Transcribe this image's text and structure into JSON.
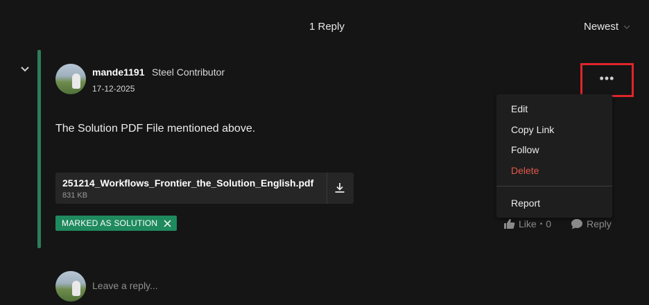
{
  "thread": {
    "reply_count": "1 Reply",
    "sort_label": "Newest"
  },
  "post": {
    "username": "mande1191",
    "rank": "Steel Contributor",
    "date": "17-12-2025",
    "body": "The Solution PDF File mentioned above.",
    "attachment": {
      "filename": "251214_Workflows_Frontier_the_Solution_English.pdf",
      "size": "831 KB"
    },
    "solution_badge": "MARKED AS SOLUTION",
    "like_label": "Like",
    "like_count": "0",
    "like_separator": "•",
    "reply_label": "Reply"
  },
  "menu": {
    "items": [
      {
        "label": "Edit"
      },
      {
        "label": "Copy Link"
      },
      {
        "label": "Follow"
      },
      {
        "label": "Delete",
        "color": "#e2584a"
      },
      {
        "label": "Report"
      }
    ]
  },
  "composer": {
    "placeholder": "Leave a reply..."
  },
  "colors": {
    "accent_bar": "#2e7d5a",
    "badge": "#1f8a5e",
    "highlight_border": "#e0252b",
    "danger": "#e2584a"
  },
  "icons": [
    "chevron-down-icon",
    "download-icon",
    "close-icon",
    "more-icon",
    "like-icon",
    "reply-icon"
  ]
}
